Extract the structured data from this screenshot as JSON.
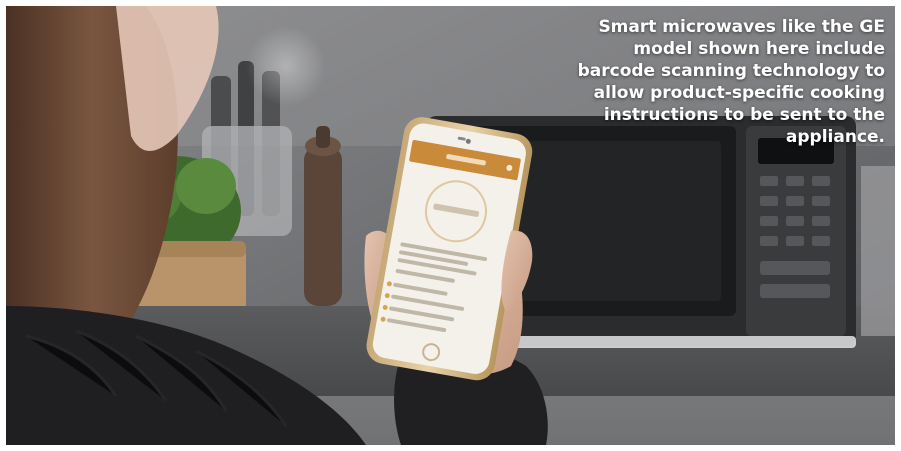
{
  "caption": {
    "text": "Smart microwaves like the GE model shown here include barcode scanning technology to allow product-specific cooking instructions to be sent to the appliance."
  },
  "photo": {
    "scene": "kitchen-countertop-with-microwave-and-hand-holding-phone",
    "icons": [
      "microwave-icon",
      "smartphone-icon",
      "plant-icon",
      "knife-block-icon",
      "pepper-mill-icon"
    ]
  },
  "phone_app": {
    "header_color": "#c98a3a",
    "accent_color": "#d8a44f"
  },
  "colors": {
    "frame": "#ffffff",
    "caption_text": "#ffffff",
    "sweater": "#1f1f22",
    "hair": "#6b4a36"
  }
}
